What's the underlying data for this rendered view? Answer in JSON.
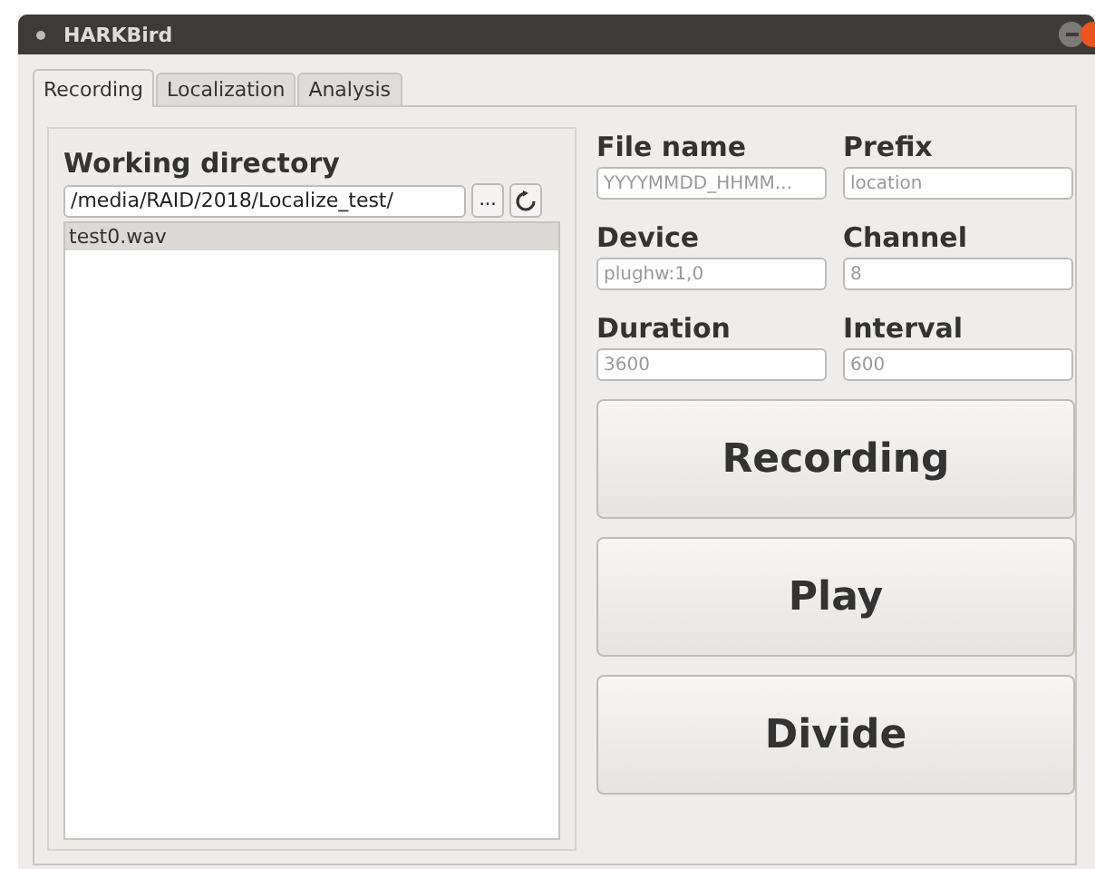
{
  "window": {
    "title": "HARKBird"
  },
  "tabs": [
    {
      "label": "Recording",
      "selected": true
    },
    {
      "label": "Localization",
      "selected": false
    },
    {
      "label": "Analysis",
      "selected": false
    }
  ],
  "working_directory": {
    "label": "Working directory",
    "value": "/media/RAID/2018/Localize_test/",
    "browse": "...",
    "files": [
      {
        "name": "test0.wav",
        "selected": true
      }
    ]
  },
  "fields": [
    {
      "label": "File name",
      "placeholder": "YYYYMMDD_HHMM..."
    },
    {
      "label": "Prefix",
      "placeholder": "location"
    },
    {
      "label": "Device",
      "placeholder": "plughw:1,0"
    },
    {
      "label": "Channel",
      "placeholder": "8"
    },
    {
      "label": "Duration",
      "placeholder": "3600"
    },
    {
      "label": "Interval",
      "placeholder": "600"
    }
  ],
  "buttons": [
    "Recording",
    "Play",
    "Divide"
  ]
}
